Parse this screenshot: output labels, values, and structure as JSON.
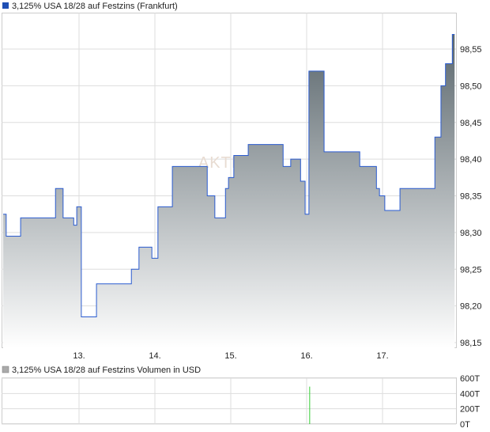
{
  "chart_data": [
    {
      "type": "area",
      "title": "3,125% USA 18/28 auf Festzins (Frankfurt)",
      "watermark": "AKTIEN",
      "x_ticks": [
        {
          "day": 13,
          "label": "13."
        },
        {
          "day": 14,
          "label": "14."
        },
        {
          "day": 15,
          "label": "15."
        },
        {
          "day": 16,
          "label": "16."
        },
        {
          "day": 17,
          "label": "17."
        }
      ],
      "xlim": [
        12.0,
        18.0
      ],
      "ylim": [
        98.14,
        98.6
      ],
      "y_ticks": [
        "98,55",
        "98,50",
        "98,45",
        "98,40",
        "98,35",
        "98,30",
        "98,25",
        "98,20",
        "98,15"
      ],
      "y_tick_values": [
        98.55,
        98.5,
        98.45,
        98.4,
        98.35,
        98.3,
        98.25,
        98.2,
        98.15
      ],
      "step": true,
      "points": [
        [
          12.0,
          98.325
        ],
        [
          12.04,
          98.295
        ],
        [
          12.23,
          98.32
        ],
        [
          12.69,
          98.36
        ],
        [
          12.79,
          98.32
        ],
        [
          12.93,
          98.31
        ],
        [
          12.97,
          98.335
        ],
        [
          13.03,
          98.185
        ],
        [
          13.23,
          98.23
        ],
        [
          13.69,
          98.25
        ],
        [
          13.79,
          98.28
        ],
        [
          13.96,
          98.265
        ],
        [
          14.04,
          98.335
        ],
        [
          14.23,
          98.39
        ],
        [
          14.69,
          98.35
        ],
        [
          14.79,
          98.32
        ],
        [
          14.93,
          98.36
        ],
        [
          14.97,
          98.375
        ],
        [
          15.04,
          98.405
        ],
        [
          15.23,
          98.42
        ],
        [
          15.69,
          98.39
        ],
        [
          15.79,
          98.4
        ],
        [
          15.92,
          98.37
        ],
        [
          15.98,
          98.325
        ],
        [
          16.03,
          98.52
        ],
        [
          16.23,
          98.41
        ],
        [
          16.7,
          98.39
        ],
        [
          16.92,
          98.36
        ],
        [
          16.96,
          98.35
        ],
        [
          17.03,
          98.33
        ],
        [
          17.23,
          98.36
        ],
        [
          17.69,
          98.43
        ],
        [
          17.77,
          98.5
        ],
        [
          17.83,
          98.53
        ],
        [
          17.92,
          98.57
        ],
        [
          17.95,
          98.57
        ]
      ],
      "colors": {
        "line": "#2a5bd0",
        "fill_top": "#5b676d",
        "fill_bottom": "#ffffff",
        "legend": "#1f4fb5",
        "grid": "#dddddd"
      }
    },
    {
      "type": "bar",
      "title": "3,125% USA 18/28 auf Festzins Volumen in USD",
      "y_ticks": [
        "600T",
        "400T",
        "200T",
        "0T"
      ],
      "ylim": [
        0,
        600
      ],
      "bars": [
        {
          "day": 16.04,
          "value": 490
        }
      ],
      "colors": {
        "bar": "#33cc33",
        "legend": "#aaaaaa"
      }
    }
  ]
}
